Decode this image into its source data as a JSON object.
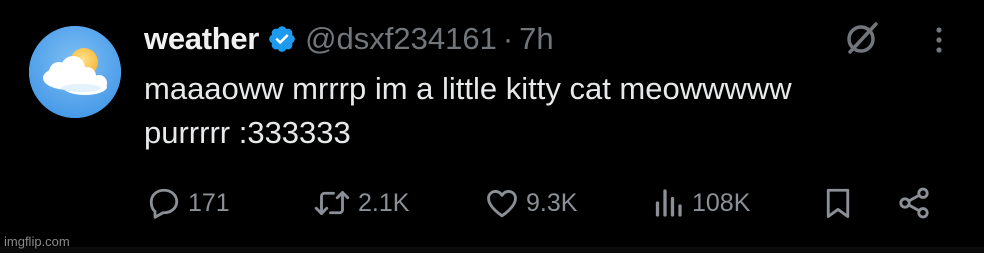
{
  "tweet": {
    "display_name": "weather",
    "handle": "@dsxf234161",
    "separator": "·",
    "time": "7h",
    "text_lines": [
      "maaaoww mrrrp im a little kitty cat meowwwww",
      "purrrrr :333333"
    ],
    "avatar": "sun-behind-cloud-avatar",
    "verified_badge": "verified-check-icon",
    "header_icons": [
      "grok-icon",
      "more-options-icon"
    ]
  },
  "actions": {
    "reply": {
      "icon": "reply-icon",
      "count": "171"
    },
    "retweet": {
      "icon": "retweet-icon",
      "count": "2.1K"
    },
    "like": {
      "icon": "heart-icon",
      "count": "9.3K"
    },
    "views": {
      "icon": "views-icon",
      "count": "108K"
    },
    "bookmark": {
      "icon": "bookmark-icon"
    },
    "share": {
      "icon": "share-icon"
    }
  },
  "watermark": "imgflip.com",
  "colors": {
    "background": "#000000",
    "text": "#e7e9ea",
    "muted": "#71767b",
    "verified": "#1d9bf0"
  }
}
